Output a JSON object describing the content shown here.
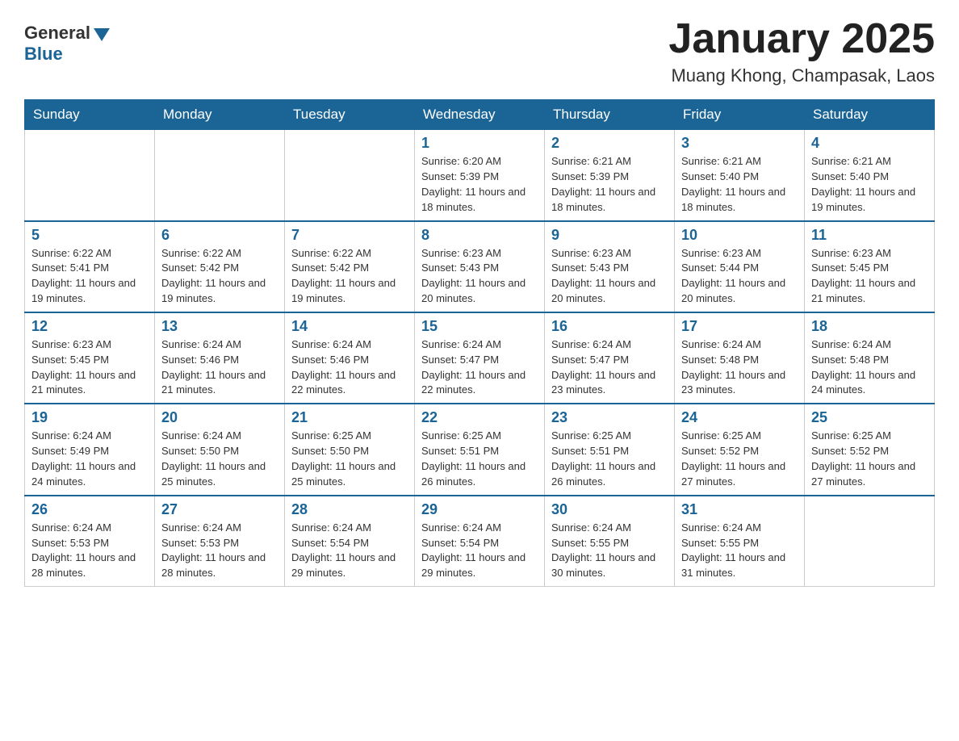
{
  "logo": {
    "general": "General",
    "blue": "Blue"
  },
  "title": "January 2025",
  "location": "Muang Khong, Champasak, Laos",
  "days_of_week": [
    "Sunday",
    "Monday",
    "Tuesday",
    "Wednesday",
    "Thursday",
    "Friday",
    "Saturday"
  ],
  "weeks": [
    [
      {
        "day": "",
        "info": ""
      },
      {
        "day": "",
        "info": ""
      },
      {
        "day": "",
        "info": ""
      },
      {
        "day": "1",
        "info": "Sunrise: 6:20 AM\nSunset: 5:39 PM\nDaylight: 11 hours and 18 minutes."
      },
      {
        "day": "2",
        "info": "Sunrise: 6:21 AM\nSunset: 5:39 PM\nDaylight: 11 hours and 18 minutes."
      },
      {
        "day": "3",
        "info": "Sunrise: 6:21 AM\nSunset: 5:40 PM\nDaylight: 11 hours and 18 minutes."
      },
      {
        "day": "4",
        "info": "Sunrise: 6:21 AM\nSunset: 5:40 PM\nDaylight: 11 hours and 19 minutes."
      }
    ],
    [
      {
        "day": "5",
        "info": "Sunrise: 6:22 AM\nSunset: 5:41 PM\nDaylight: 11 hours and 19 minutes."
      },
      {
        "day": "6",
        "info": "Sunrise: 6:22 AM\nSunset: 5:42 PM\nDaylight: 11 hours and 19 minutes."
      },
      {
        "day": "7",
        "info": "Sunrise: 6:22 AM\nSunset: 5:42 PM\nDaylight: 11 hours and 19 minutes."
      },
      {
        "day": "8",
        "info": "Sunrise: 6:23 AM\nSunset: 5:43 PM\nDaylight: 11 hours and 20 minutes."
      },
      {
        "day": "9",
        "info": "Sunrise: 6:23 AM\nSunset: 5:43 PM\nDaylight: 11 hours and 20 minutes."
      },
      {
        "day": "10",
        "info": "Sunrise: 6:23 AM\nSunset: 5:44 PM\nDaylight: 11 hours and 20 minutes."
      },
      {
        "day": "11",
        "info": "Sunrise: 6:23 AM\nSunset: 5:45 PM\nDaylight: 11 hours and 21 minutes."
      }
    ],
    [
      {
        "day": "12",
        "info": "Sunrise: 6:23 AM\nSunset: 5:45 PM\nDaylight: 11 hours and 21 minutes."
      },
      {
        "day": "13",
        "info": "Sunrise: 6:24 AM\nSunset: 5:46 PM\nDaylight: 11 hours and 21 minutes."
      },
      {
        "day": "14",
        "info": "Sunrise: 6:24 AM\nSunset: 5:46 PM\nDaylight: 11 hours and 22 minutes."
      },
      {
        "day": "15",
        "info": "Sunrise: 6:24 AM\nSunset: 5:47 PM\nDaylight: 11 hours and 22 minutes."
      },
      {
        "day": "16",
        "info": "Sunrise: 6:24 AM\nSunset: 5:47 PM\nDaylight: 11 hours and 23 minutes."
      },
      {
        "day": "17",
        "info": "Sunrise: 6:24 AM\nSunset: 5:48 PM\nDaylight: 11 hours and 23 minutes."
      },
      {
        "day": "18",
        "info": "Sunrise: 6:24 AM\nSunset: 5:48 PM\nDaylight: 11 hours and 24 minutes."
      }
    ],
    [
      {
        "day": "19",
        "info": "Sunrise: 6:24 AM\nSunset: 5:49 PM\nDaylight: 11 hours and 24 minutes."
      },
      {
        "day": "20",
        "info": "Sunrise: 6:24 AM\nSunset: 5:50 PM\nDaylight: 11 hours and 25 minutes."
      },
      {
        "day": "21",
        "info": "Sunrise: 6:25 AM\nSunset: 5:50 PM\nDaylight: 11 hours and 25 minutes."
      },
      {
        "day": "22",
        "info": "Sunrise: 6:25 AM\nSunset: 5:51 PM\nDaylight: 11 hours and 26 minutes."
      },
      {
        "day": "23",
        "info": "Sunrise: 6:25 AM\nSunset: 5:51 PM\nDaylight: 11 hours and 26 minutes."
      },
      {
        "day": "24",
        "info": "Sunrise: 6:25 AM\nSunset: 5:52 PM\nDaylight: 11 hours and 27 minutes."
      },
      {
        "day": "25",
        "info": "Sunrise: 6:25 AM\nSunset: 5:52 PM\nDaylight: 11 hours and 27 minutes."
      }
    ],
    [
      {
        "day": "26",
        "info": "Sunrise: 6:24 AM\nSunset: 5:53 PM\nDaylight: 11 hours and 28 minutes."
      },
      {
        "day": "27",
        "info": "Sunrise: 6:24 AM\nSunset: 5:53 PM\nDaylight: 11 hours and 28 minutes."
      },
      {
        "day": "28",
        "info": "Sunrise: 6:24 AM\nSunset: 5:54 PM\nDaylight: 11 hours and 29 minutes."
      },
      {
        "day": "29",
        "info": "Sunrise: 6:24 AM\nSunset: 5:54 PM\nDaylight: 11 hours and 29 minutes."
      },
      {
        "day": "30",
        "info": "Sunrise: 6:24 AM\nSunset: 5:55 PM\nDaylight: 11 hours and 30 minutes."
      },
      {
        "day": "31",
        "info": "Sunrise: 6:24 AM\nSunset: 5:55 PM\nDaylight: 11 hours and 31 minutes."
      },
      {
        "day": "",
        "info": ""
      }
    ]
  ]
}
